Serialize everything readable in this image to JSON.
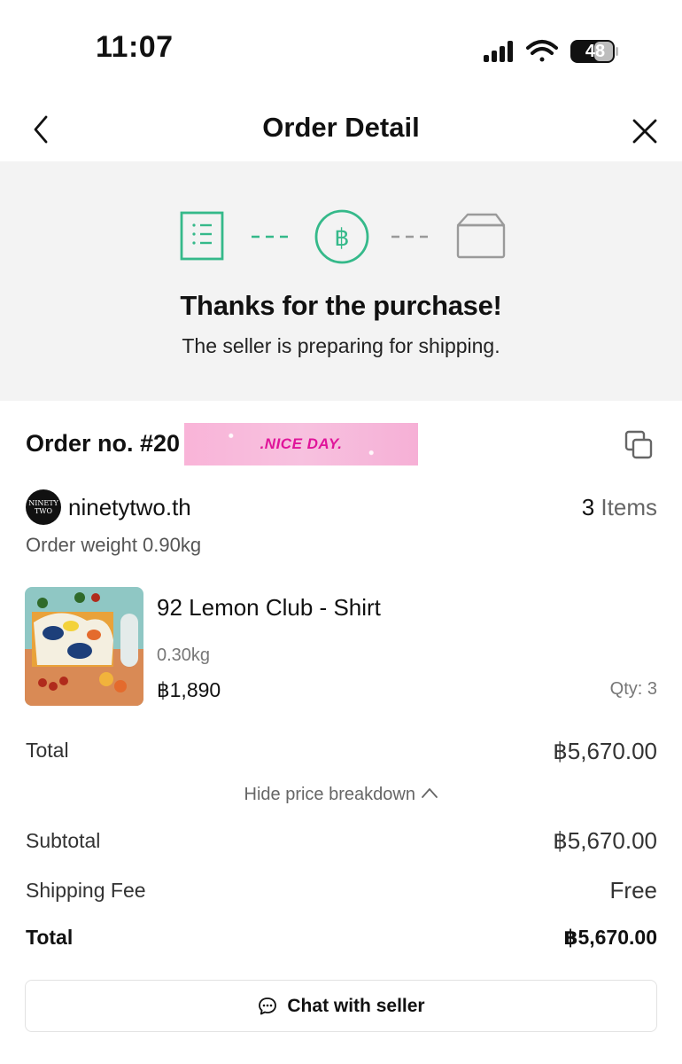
{
  "status_bar": {
    "time": "11:07",
    "battery": "48"
  },
  "nav": {
    "title": "Order Detail",
    "back_icon": "chevron-left-icon",
    "close_icon": "close-icon"
  },
  "banner": {
    "steps": [
      {
        "icon": "receipt-list-icon",
        "state": "done"
      },
      {
        "icon": "baht-coin-icon",
        "state": "current"
      },
      {
        "icon": "box-icon",
        "state": "pending"
      }
    ],
    "title": "Thanks for the purchase!",
    "subtitle": "The seller is preparing for shipping."
  },
  "order": {
    "number_label": "Order no. #20",
    "sticker_text": ".NICE DAY.",
    "copy_icon": "copy-icon"
  },
  "seller": {
    "logo_text_1": "NINETY",
    "logo_text_2": "TWO",
    "name": "ninetytwo.th",
    "items_count": "3",
    "items_word": "Items",
    "order_weight": "Order weight 0.90kg"
  },
  "product": {
    "name": "92 Lemon Club - Shirt",
    "weight": "0.30kg",
    "price": "฿1,890",
    "qty": "Qty: 3"
  },
  "summary": {
    "total_label": "Total",
    "total_value": "฿5,670.00",
    "hide_breakdown": "Hide price breakdown",
    "subtotal_label": "Subtotal",
    "subtotal_value": "฿5,670.00",
    "shipping_label": "Shipping Fee",
    "shipping_value": "Free",
    "final_total_label": "Total",
    "final_total_value": "฿5,670.00"
  },
  "chat": {
    "label": "Chat with seller"
  },
  "colors": {
    "accent_green": "#35b98a",
    "pending_gray": "#9a9a9a",
    "banner_bg": "#f3f3f3"
  }
}
